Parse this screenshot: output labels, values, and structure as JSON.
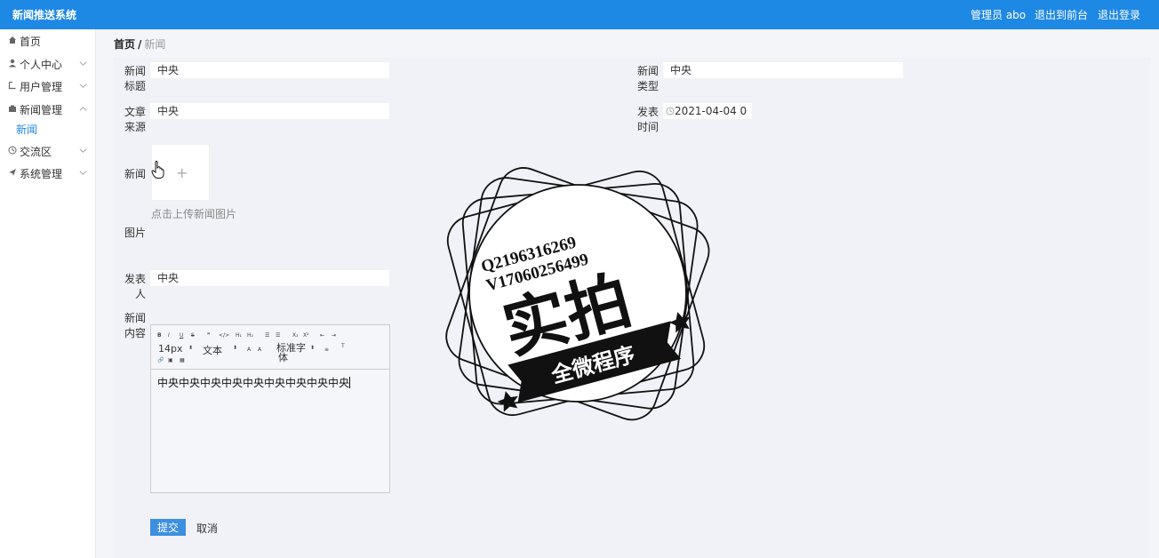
{
  "header": {
    "app_title": "新闻推送系统",
    "user": "管理员 abo",
    "front_link": "退出到前台",
    "logout_link": "退出登录"
  },
  "sidebar": {
    "items": [
      {
        "label": "首页",
        "icon": "home-icon"
      },
      {
        "label": "个人中心",
        "icon": "person-icon"
      },
      {
        "label": "用户管理",
        "icon": "square-icon"
      },
      {
        "label": "新闻管理",
        "icon": "folder-icon"
      },
      {
        "label": "交流区",
        "icon": "clock-icon"
      },
      {
        "label": "系统管理",
        "icon": "send-icon"
      }
    ],
    "sub_items": [
      "新闻"
    ]
  },
  "breadcrumb": {
    "home": "首页",
    "separator": "/",
    "current": "新闻"
  },
  "form": {
    "title_label_1": "新闻",
    "title_label_2": "标题",
    "title_value": "中央",
    "type_label_1": "新闻",
    "type_label_2": "类型",
    "type_value": "中央",
    "source_label_1": "文章",
    "source_label_2": "来源",
    "source_value": "中央",
    "time_label_1": "发表",
    "time_label_2": "时间",
    "time_value": "2021-04-04 0",
    "image_label_1": "新闻",
    "image_label_2": "图片",
    "upload_plus": "+",
    "upload_tip": "点击上传新闻图片",
    "author_label_1": "发表",
    "author_label_2": "人",
    "author_value": "中央",
    "content_label_1": "新闻",
    "content_label_2": "内容",
    "content_value": "中央中央中央中央中央中央中央中央中央"
  },
  "editor_toolbar": {
    "font_size": "14px",
    "text_style": "文本",
    "font_family": "标准字体",
    "font_family_line1": "标准字",
    "font_family_line2": "体"
  },
  "actions": {
    "submit": "提交",
    "cancel": "取消"
  },
  "watermark": {
    "line1": "Q2196316269",
    "line2": "V17060256499",
    "main": "实拍",
    "banner": "全微程序"
  },
  "colors": {
    "header_bg": "#1e88e5",
    "accent": "#1e88e5",
    "submit_bg": "#3d8fe0"
  }
}
